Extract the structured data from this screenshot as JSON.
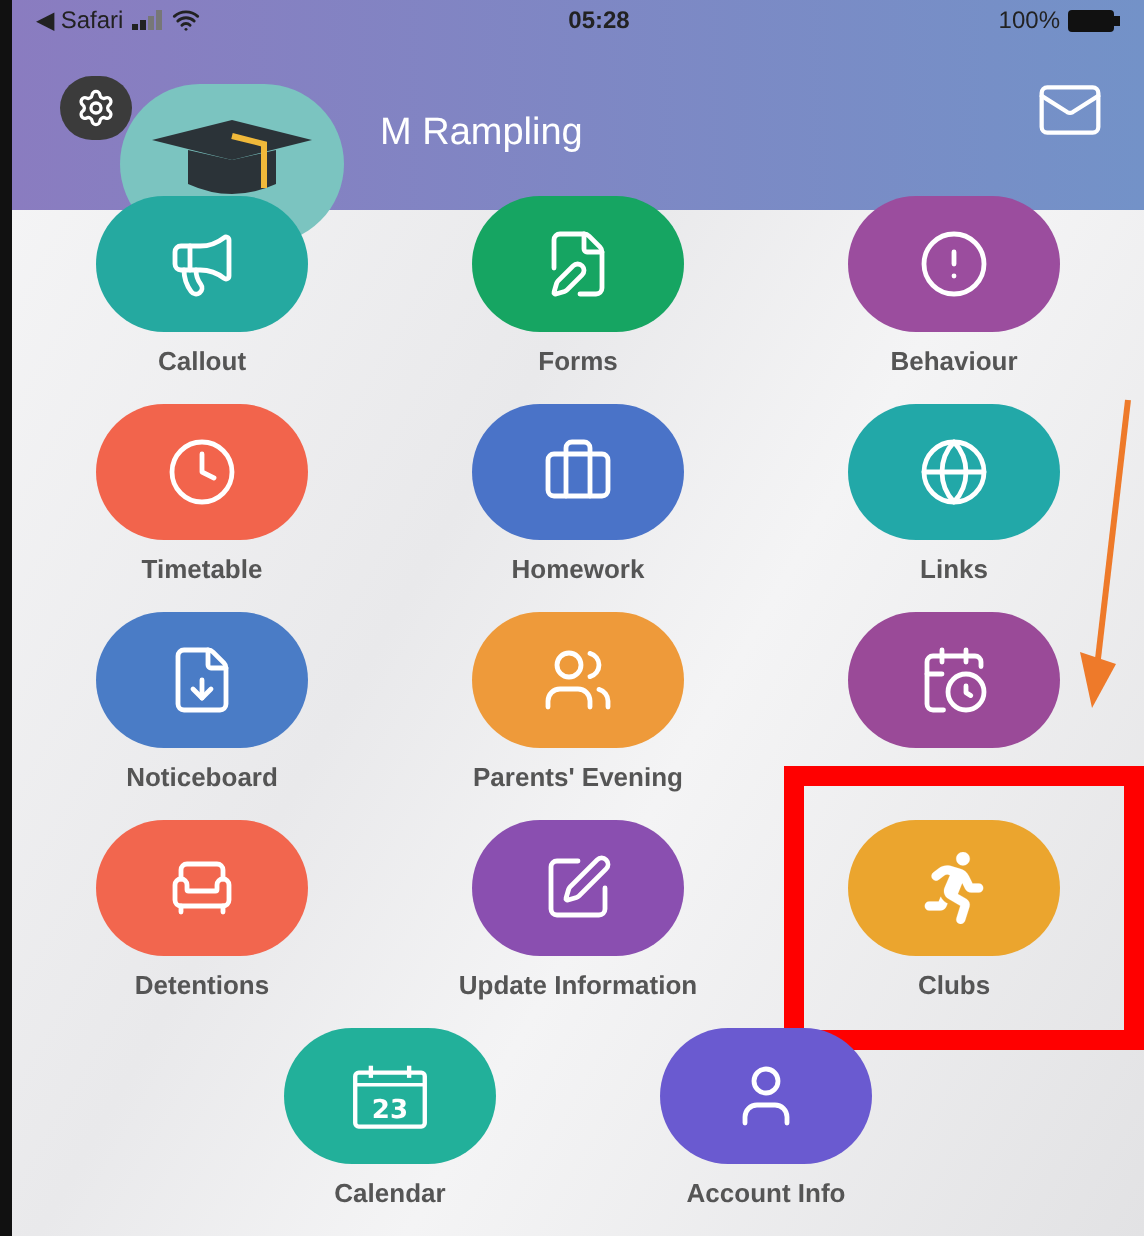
{
  "status_bar": {
    "back_label": "◀ Safari",
    "time": "05:28",
    "battery": "100%"
  },
  "header": {
    "user_name": "M Rampling"
  },
  "tiles": [
    {
      "label": "Callout",
      "color": "#25a9a0",
      "highlighted": false
    },
    {
      "label": "Forms",
      "color": "#16a562",
      "highlighted": false
    },
    {
      "label": "Behaviour",
      "color": "#9b4d9e",
      "highlighted": false
    },
    {
      "label": "Timetable",
      "color": "#f2644c",
      "highlighted": false
    },
    {
      "label": "Homework",
      "color": "#4a73c8",
      "highlighted": false
    },
    {
      "label": "Links",
      "color": "#22a8a8",
      "highlighted": false
    },
    {
      "label": "Noticeboard",
      "color": "#4a7cc6",
      "highlighted": false
    },
    {
      "label": "Parents' Evening",
      "color": "#ee9a3a",
      "highlighted": false
    },
    {
      "color": "#9a4a98",
      "highlighted": false
    },
    {
      "label": "Detentions",
      "color": "#f2664e",
      "highlighted": false
    },
    {
      "label": "Update Information",
      "color": "#8a4fb0",
      "highlighted": false
    },
    {
      "label": "Clubs",
      "color": "#eba52e",
      "highlighted": true
    },
    {
      "label": "Calendar",
      "color": "#22b09a",
      "highlighted": false,
      "icon_text": "23"
    },
    {
      "label": "Account Info",
      "color": "#6a5ad0",
      "highlighted": false
    }
  ]
}
